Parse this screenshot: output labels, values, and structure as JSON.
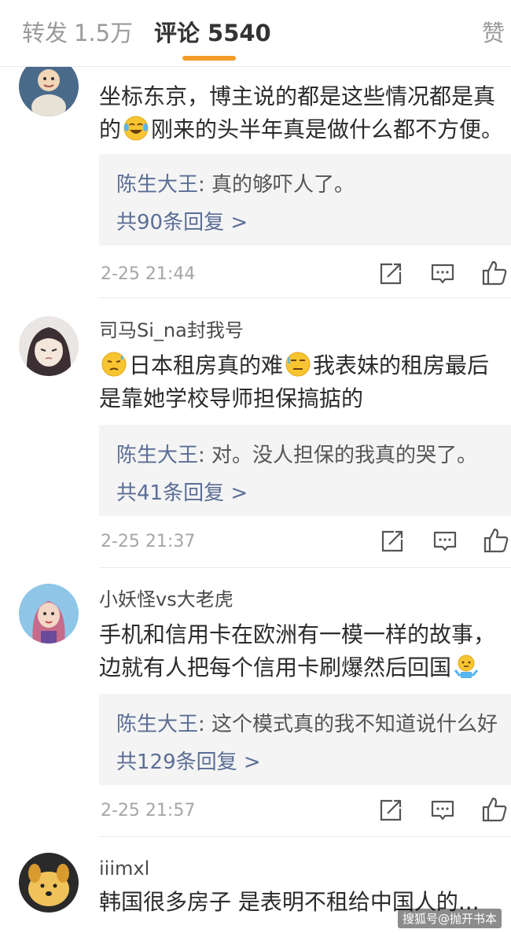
{
  "tabs": {
    "repost_label": "转发",
    "repost_count": "1.5万",
    "comments_label": "评论",
    "comments_count": "5540",
    "likes_label": "赞"
  },
  "colors": {
    "accent": "#f39c2a",
    "reply_author": "#5b6e96",
    "reply_background": "#f4f4f4"
  },
  "comments": [
    {
      "username": "",
      "text_line1": "坐标东京，博主说的都是这些情况都是真",
      "text_line2_a": "的",
      "text_line2_b": "刚来的头半年真是做什么都不方便。",
      "emojis": [
        "laughing-tears-emoji"
      ],
      "reply_author": "陈生大王",
      "reply_text": ": 真的够吓人了。",
      "reply_count": "共90条回复 >",
      "time": "2-25 21:44"
    },
    {
      "username": "司马Si_na封我号",
      "text_line1_a": "日本租房真的难",
      "text_line1_b": "我表妹的租房最后",
      "text_line2": "是靠她学校导师担保搞掂的",
      "emojis": [
        "sweat-emoji",
        "speechless-emoji"
      ],
      "reply_author": "陈生大王",
      "reply_text": ": 对。没人担保的我真的哭了。",
      "reply_count": "共41条回复 >",
      "time": "2-25 21:37"
    },
    {
      "username": "小妖怪vs大老虎",
      "text_line1": "手机和信用卡在欧洲有一模一样的故事，",
      "text_line2": "边就有人把每个信用卡刷爆然后回国",
      "emojis": [
        "shrug-emoji"
      ],
      "reply_author": "陈生大王",
      "reply_text": ": 这个模式真的我不知道说什么好",
      "reply_count": "共129条回复 >",
      "time": "2-25 21:57"
    },
    {
      "username": "iiimxl",
      "text_line1": "韩国很多房子 是表明不租给中国人的...",
      "emojis": []
    }
  ],
  "icons": [
    "repost-icon",
    "comment-icon",
    "like-icon"
  ],
  "watermark": "搜狐号@抛开书本"
}
